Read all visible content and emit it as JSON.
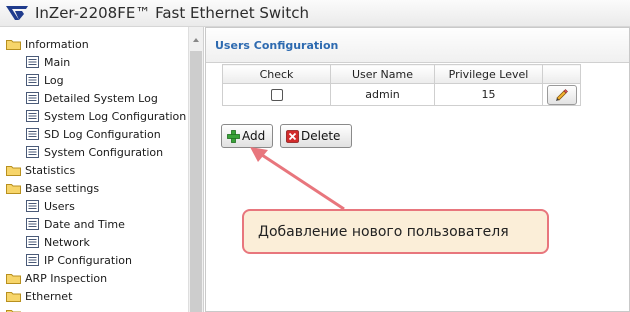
{
  "header": {
    "title": "InZer-2208FE™ Fast Ethernet Switch",
    "logo_icon": "inzer-logo-icon"
  },
  "sidebar": {
    "groups": [
      {
        "label": "Information",
        "items": [
          "Main",
          "Log",
          "Detailed System Log",
          "System Log Configuration",
          "SD Log Configuration",
          "System Configuration"
        ]
      },
      {
        "label": "Statistics",
        "items": []
      },
      {
        "label": "Base settings",
        "items": [
          "Users",
          "Date and Time",
          "Network",
          "IP Configuration"
        ]
      },
      {
        "label": "ARP Inspection",
        "items": []
      },
      {
        "label": "Ethernet",
        "items": []
      }
    ]
  },
  "main": {
    "panel_title": "Users Configuration",
    "table": {
      "columns": [
        "Check",
        "User Name",
        "Privilege Level"
      ],
      "rows": [
        {
          "checked": false,
          "user_name": "admin",
          "privilege_level": "15"
        }
      ]
    },
    "buttons": {
      "add_label": "Add",
      "delete_label": "Delete"
    }
  },
  "annotation": {
    "text": "Добавление нового пользователя",
    "border_color": "#e8767d",
    "fill_color": "#fbeed8"
  },
  "colors": {
    "panel_title": "#2d6ab0",
    "logo": "#1f3b8c",
    "add_icon": "#3aa33a",
    "delete_icon": "#d22b2b"
  }
}
